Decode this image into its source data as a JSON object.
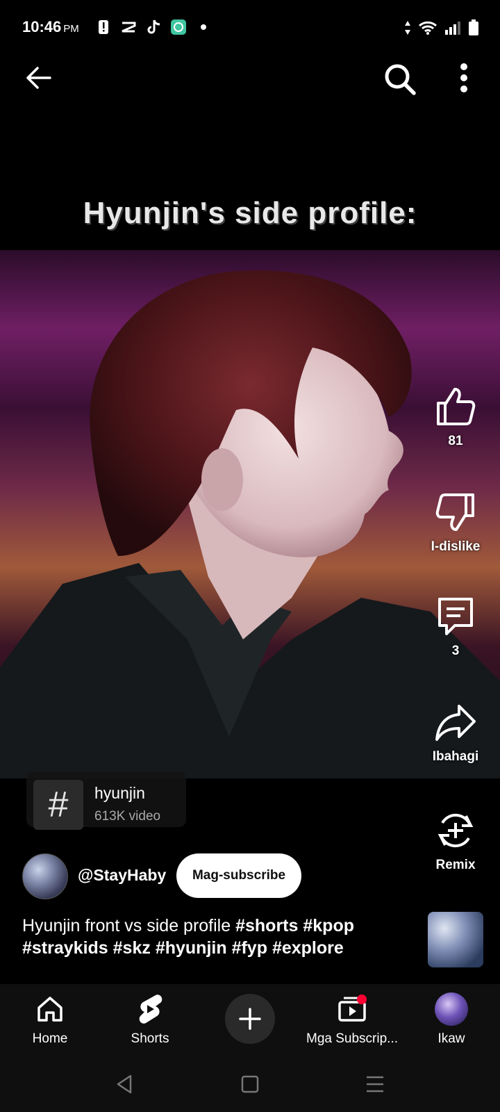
{
  "status_bar": {
    "time": "10:46",
    "ampm": "PM",
    "icons": [
      "alert-icon",
      "capcut-icon",
      "tiktok-icon",
      "app-icon",
      "dot-icon"
    ],
    "right_icons": [
      "data-arrows-icon",
      "wifi-icon",
      "signal-icon",
      "battery-icon"
    ]
  },
  "top_bar": {
    "back": "back-arrow-icon",
    "search": "search-icon",
    "more": "more-vertical-icon"
  },
  "video": {
    "overlay_text": "Hyunjin's side profile:"
  },
  "actions": {
    "like_count": "81",
    "dislike_label": "I-dislike",
    "comment_count": "3",
    "share_label": "Ibahagi",
    "remix_label": "Remix"
  },
  "hashtag": {
    "symbol": "#",
    "name": "hyunjin",
    "count": "613K video"
  },
  "channel": {
    "handle": "@StayHaby",
    "subscribe_label": "Mag-subscribe"
  },
  "description": {
    "text": "Hyunjin front vs side profile",
    "tags": [
      "#shorts",
      "#kpop",
      "#straykids",
      "#skz",
      "#hyunjin",
      "#fyp",
      "#explore"
    ]
  },
  "bottom_nav": {
    "home": "Home",
    "shorts": "Shorts",
    "subscriptions": "Mga Subscrip...",
    "you": "Ikaw"
  },
  "colors": {
    "background": "#000000",
    "nav_bg": "#0f0f0f",
    "accent_red": "#ff0033",
    "subscribe_bg": "#ffffff"
  }
}
